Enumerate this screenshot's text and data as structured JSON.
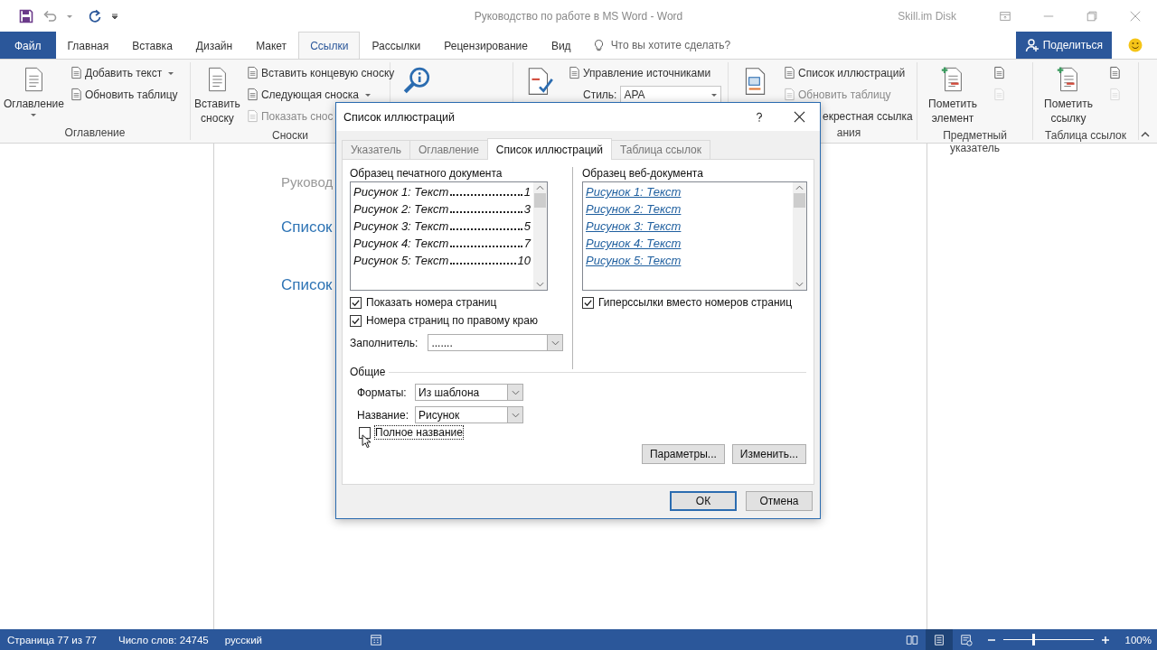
{
  "window": {
    "title": "Руководство по работе в MS Word  -  Word",
    "account": "Skill.im Disk"
  },
  "ribbon_tabs": [
    {
      "label": "Файл",
      "kind": "file",
      "selected": false
    },
    {
      "label": "Главная",
      "kind": "tab",
      "selected": false
    },
    {
      "label": "Вставка",
      "kind": "tab",
      "selected": false
    },
    {
      "label": "Дизайн",
      "kind": "tab",
      "selected": false
    },
    {
      "label": "Макет",
      "kind": "tab",
      "selected": false
    },
    {
      "label": "Ссылки",
      "kind": "tab",
      "selected": true
    },
    {
      "label": "Рассылки",
      "kind": "tab",
      "selected": false
    },
    {
      "label": "Рецензирование",
      "kind": "tab",
      "selected": false
    },
    {
      "label": "Вид",
      "kind": "tab",
      "selected": false
    }
  ],
  "tell_me": {
    "placeholder": "Что вы хотите сделать?"
  },
  "share_button": "Поделиться",
  "ribbon_groups": [
    {
      "label": "Оглавление",
      "columns": [
        [
          {
            "kind": "large",
            "label": "Оглавление",
            "caret": true
          }
        ],
        [
          {
            "kind": "small",
            "label": "Добавить текст",
            "caret": true,
            "disabled": false
          },
          {
            "kind": "small",
            "label": "Обновить таблицу",
            "disabled": false
          }
        ]
      ]
    },
    {
      "label": "Сноски",
      "columns": [
        [
          {
            "kind": "large",
            "label": "Вставить сноску"
          }
        ],
        [
          {
            "kind": "small",
            "label": "Вставить концевую сноску",
            "disabled": false
          },
          {
            "kind": "small",
            "label": "Следующая сноска",
            "caret": true,
            "disabled": false
          },
          {
            "kind": "small",
            "label": "Показать снос",
            "disabled": true
          }
        ]
      ]
    },
    {
      "columns": [
        [
          {
            "kind": "large-icon"
          }
        ]
      ]
    },
    {
      "columns": [
        [
          {
            "kind": "large-icon"
          }
        ],
        [
          {
            "kind": "small",
            "label": "Управление источниками",
            "disabled": false
          },
          {
            "kind": "combo",
            "label": "Стиль:",
            "value": "APA"
          }
        ]
      ]
    },
    {
      "label": "ания",
      "columns": [
        [
          {
            "kind": "large-icon"
          }
        ],
        [
          {
            "kind": "small",
            "label": "Список иллюстраций",
            "disabled": false
          },
          {
            "kind": "small",
            "label": "Обновить таблицу",
            "disabled": true
          },
          {
            "kind": "text",
            "label": "екрестная ссылка"
          }
        ]
      ]
    },
    {
      "label": "Предметный указатель",
      "columns": [
        [
          {
            "kind": "large",
            "label": "Пометить элемент"
          }
        ],
        [
          {
            "kind": "icon",
            "disabled": false
          },
          {
            "kind": "icon",
            "disabled": true
          }
        ]
      ]
    },
    {
      "label": "Таблица ссылок",
      "columns": [
        [
          {
            "kind": "large",
            "label": "Пометить ссылку"
          }
        ],
        [
          {
            "kind": "icon",
            "disabled": false
          },
          {
            "kind": "icon",
            "disabled": true
          }
        ]
      ]
    }
  ],
  "document": {
    "header": "Руковод",
    "headings": [
      "Список",
      "Список"
    ]
  },
  "dialog": {
    "title": "Список иллюстраций",
    "tabs": [
      {
        "label": "Указатель",
        "selected": false
      },
      {
        "label": "Оглавление",
        "selected": false
      },
      {
        "label": "Список иллюстраций",
        "selected": true
      },
      {
        "label": "Таблица ссылок",
        "selected": false
      }
    ],
    "print_preview": {
      "label": "Образец печатного документа",
      "entries": [
        {
          "text": "Рисунок 1: Текст",
          "page": "1"
        },
        {
          "text": "Рисунок 2: Текст",
          "page": "3"
        },
        {
          "text": "Рисунок 3: Текст",
          "page": "5"
        },
        {
          "text": "Рисунок 4: Текст",
          "page": "7"
        },
        {
          "text": "Рисунок 5: Текст",
          "page": "10"
        }
      ]
    },
    "print_options": [
      {
        "label": "Показать номера страниц",
        "checked": true
      },
      {
        "label": "Номера страниц по правому краю",
        "checked": true
      }
    ],
    "leader": {
      "label": "Заполнитель:",
      "value": "......."
    },
    "web_preview": {
      "label": "Образец веб-документа",
      "entries": [
        "Рисунок 1: Текст",
        "Рисунок 2: Текст",
        "Рисунок 3: Текст",
        "Рисунок 4: Текст",
        "Рисунок 5: Текст"
      ]
    },
    "web_options": [
      {
        "label": "Гиперссылки вместо номеров страниц",
        "checked": true
      }
    ],
    "general": {
      "label": "Общие",
      "formats": {
        "label": "Форматы:",
        "value": "Из шаблона"
      },
      "caption": {
        "label": "Название:",
        "value": "Рисунок"
      },
      "full_caption": {
        "label": "Полное название",
        "checked": false
      }
    },
    "panel_buttons": [
      "Параметры...",
      "Изменить..."
    ],
    "buttons": [
      {
        "label": "ОК",
        "kind": "default"
      },
      {
        "label": "Отмена",
        "kind": "normal"
      }
    ]
  },
  "status_bar": {
    "page": "Страница 77 из 77",
    "words": "Число слов: 24745",
    "language": "русский",
    "views": [
      {
        "selected": false
      },
      {
        "selected": true
      },
      {
        "selected": false
      }
    ],
    "zoom": {
      "level": 0.33,
      "reading": "100%"
    }
  }
}
